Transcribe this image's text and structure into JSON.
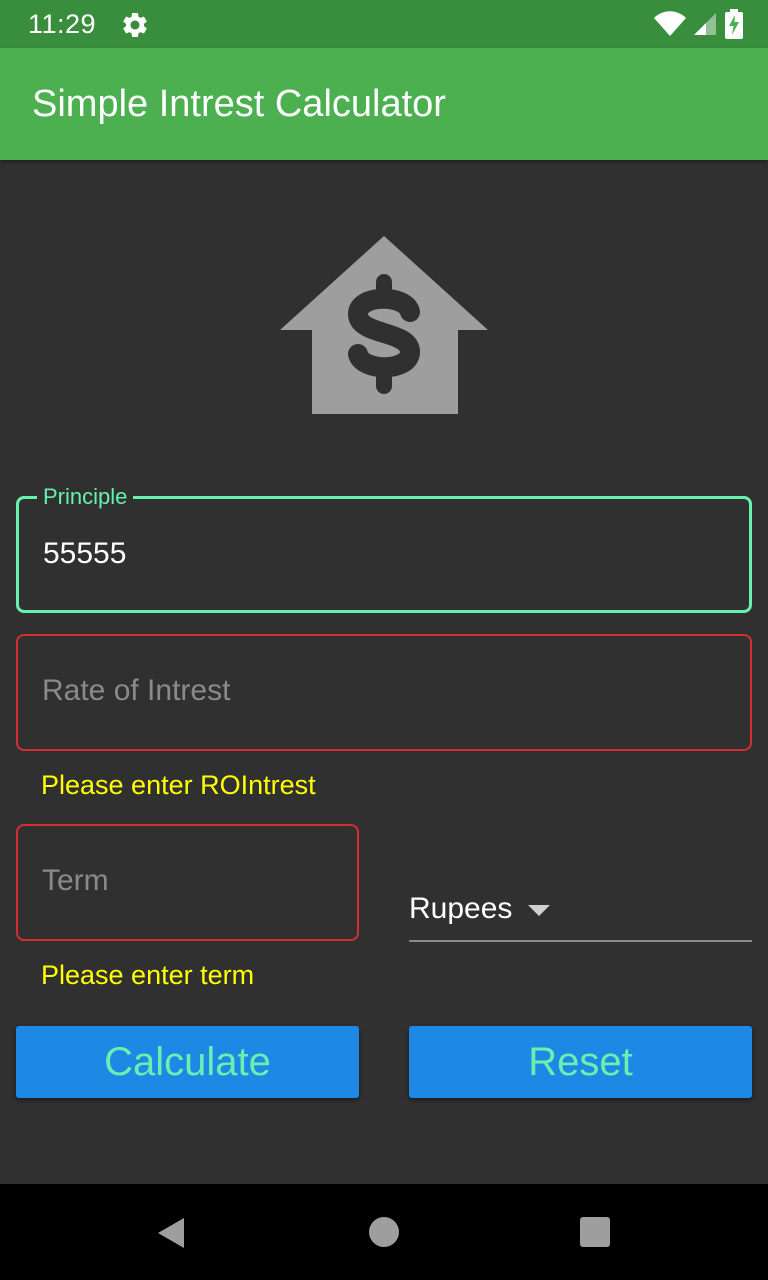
{
  "status_bar": {
    "time": "11:29",
    "icons": [
      "gear-icon",
      "wifi-icon",
      "signal-icon",
      "battery-charging-icon"
    ]
  },
  "app_bar": {
    "title": "Simple Intrest Calculator"
  },
  "hero": {
    "icon": "house-dollar-icon",
    "color": "#9e9e9e"
  },
  "form": {
    "principle": {
      "label": "Principle",
      "value": "55555"
    },
    "rate": {
      "placeholder": "Rate of Intrest",
      "error": "Please enter ROIntrest"
    },
    "term": {
      "placeholder": "Term",
      "error": "Please enter term"
    },
    "currency": {
      "selected": "Rupees"
    }
  },
  "buttons": {
    "calculate": "Calculate",
    "reset": "Reset"
  },
  "nav_bar": {
    "icons": [
      "back-icon",
      "home-icon",
      "recents-icon"
    ]
  },
  "colors": {
    "app_bar": "#4caf50",
    "status_bar": "#388e3c",
    "background": "#303030",
    "accent": "#69f0ae",
    "error_border": "#d32f2f",
    "error_text": "#ffff00",
    "button": "#1e88e5"
  }
}
